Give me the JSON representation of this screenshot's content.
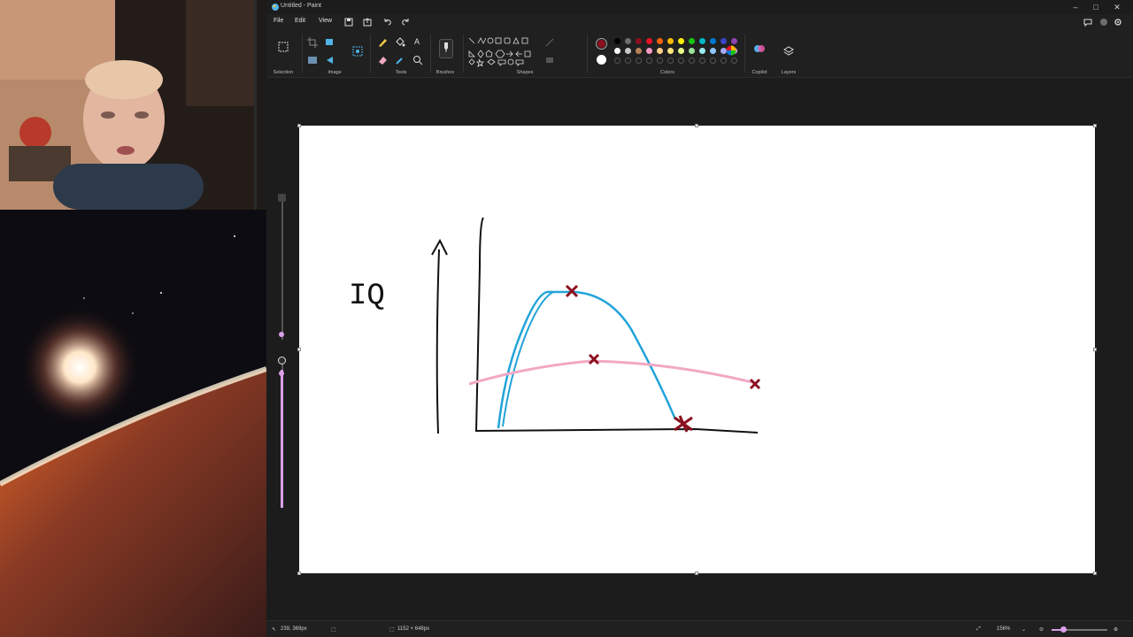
{
  "window": {
    "title": "Untitled - Paint"
  },
  "menu": {
    "file": "File",
    "edit": "Edit",
    "view": "View"
  },
  "ribbon": {
    "groups": {
      "selection": "Selection",
      "image": "Image",
      "tools": "Tools",
      "brushes": "Brushes",
      "shapes": "Shapes",
      "colors": "Colors",
      "copilot": "Copilot",
      "layers": "Layers"
    },
    "primary_color": "#8b0f1e",
    "secondary_color": "#ffffff",
    "palette_row1": [
      "#000000",
      "#6e6e6e",
      "#8b0f1e",
      "#e81123",
      "#f7630c",
      "#ffb900",
      "#fff100",
      "#16c60c",
      "#00b7c3",
      "#0078d4",
      "#3a46c9",
      "#8e44ad"
    ],
    "palette_row2": [
      "#ffffff",
      "#c8c8c8",
      "#b5835a",
      "#f49ac2",
      "#ffd08a",
      "#ffe680",
      "#e6ff8a",
      "#9be59b",
      "#9ae8f0",
      "#8ec5ff",
      "#a5a9f5",
      "#d5a6f0"
    ]
  },
  "canvas": {
    "drawing_text": "IQ",
    "stroke_colors": {
      "axis": "#111111",
      "blue_curve": "#22a3d9",
      "pink_curve": "#f2a8c4",
      "marker": "#8b0f1e"
    }
  },
  "status": {
    "cursor_position": "239, 369px",
    "canvas_size": "1152 × 648px",
    "zoom": "156%"
  }
}
